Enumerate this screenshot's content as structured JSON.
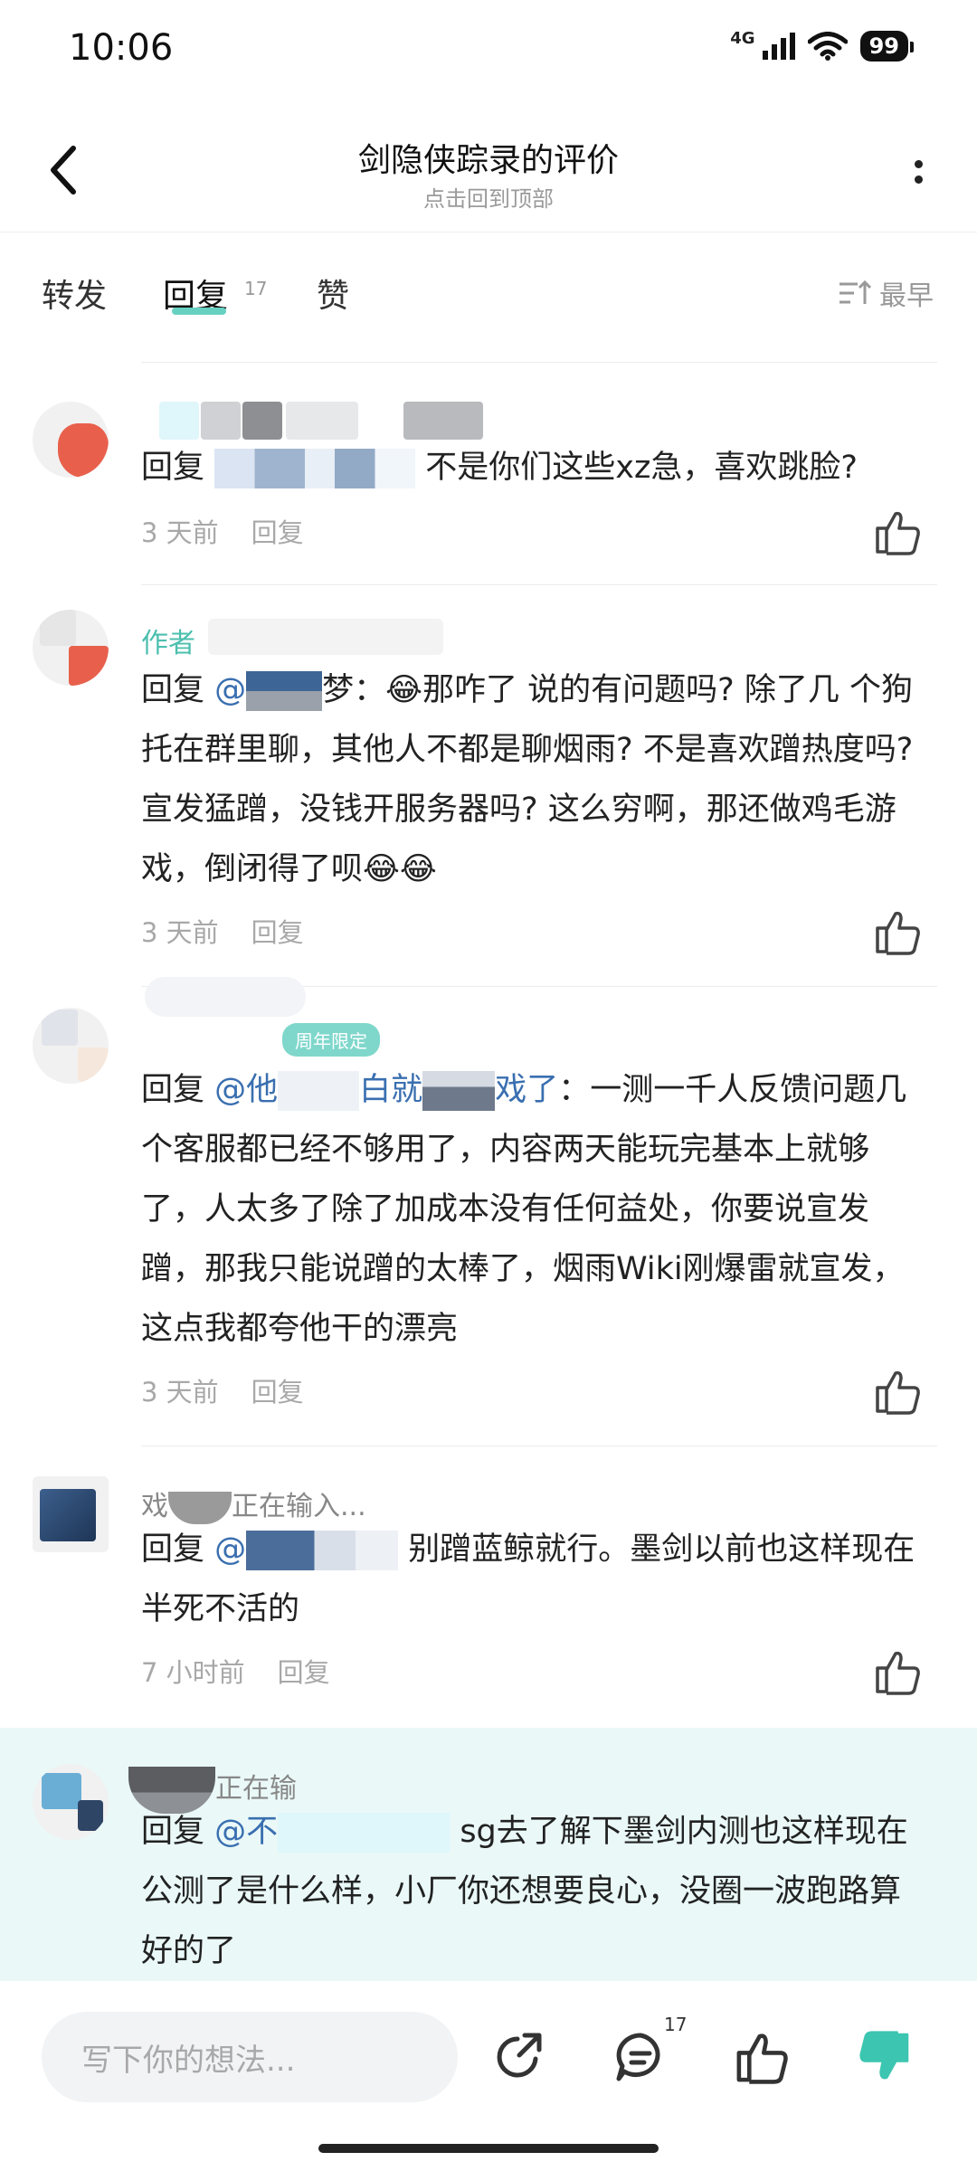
{
  "status_bar": {
    "time": "10:06",
    "network": "4G",
    "battery": "99",
    "icons": [
      "signal-icon",
      "wifi-icon",
      "battery-icon"
    ]
  },
  "header": {
    "title": "剑隐侠踪录的评价",
    "subtitle": "点击回到顶部"
  },
  "tabs": [
    {
      "label": "转发"
    },
    {
      "label": "回复",
      "count": "17",
      "active": true
    },
    {
      "label": "赞"
    }
  ],
  "sort": {
    "label": "最早"
  },
  "comments": [
    {
      "username": "",
      "prefix": "回复",
      "mention": "",
      "text": "不是你们这些xz急，喜欢跳脸?",
      "time": "3 天前",
      "reply_label": "回复"
    },
    {
      "username": "作者",
      "prefix": "回复",
      "mention": "@",
      "text_line1": "梦：😂那咋了 说的有问题吗? 除了几",
      "text_rest": "个狗托在群里聊，其他人不都是聊烟雨? 不是喜欢蹭热度吗? 宣发猛蹭，没钱开服务器吗? 这么穷啊，那还做鸡毛游戏，倒闭得了呗😂😂",
      "time": "3 天前",
      "reply_label": "回复"
    },
    {
      "badge": "周年限定",
      "prefix": "回复",
      "mention": "@他",
      "mention_tail": "白就",
      "mention_end": "戏了",
      "text": "：一测一千人反馈问题几个客服都已经不够用了，内容两天能玩完基本上就够了，人太多了除了加成本没有任何益处，你要说宣发蹭，那我只能说蹭的太棒了，烟雨Wiki刚爆雷就宣发，这点我都夸他干的漂亮",
      "time": "3 天前",
      "reply_label": "回复"
    },
    {
      "username": "戏",
      "username_tail": "正在输入...",
      "prefix": "回复",
      "mention": "@",
      "text": "别蹭蓝鲸就行。墨剑以前也这样现在半死不活的",
      "time": "7 小时前",
      "reply_label": "回复"
    },
    {
      "username": "正在输",
      "prefix": "回复",
      "mention": "@不",
      "text": "sg去了解下墨剑内测也这样现在公测了是什么样，小厂你还想要良心，没圈一波跑路算好的了"
    }
  ],
  "bottom_bar": {
    "input_placeholder": "写下你的想法...",
    "reply_count": "17",
    "icons": [
      "share-icon",
      "comment-icon",
      "like-icon",
      "dislike-icon"
    ],
    "dislike_color": "#3cc5b0"
  }
}
